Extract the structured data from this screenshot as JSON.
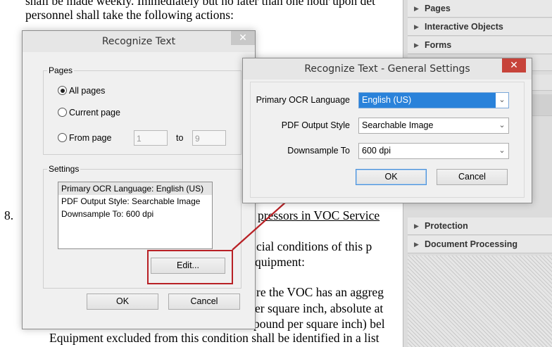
{
  "document": {
    "lines": [
      "shall be made weekly.  Immediately but no later than one hour upon det",
      "personnel shall take the following actions:",
      "8.",
      "pressors in VOC Service",
      "cial conditions of this p",
      "quipment:",
      "re the VOC has an aggreg",
      "er square inch, absolute at",
      "pound per square inch) bel",
      "Equipment excluded from this condition shall be identified in a list"
    ]
  },
  "panel": {
    "items": [
      {
        "label": "Pages"
      },
      {
        "label": "Interactive Objects"
      },
      {
        "label": "Forms"
      },
      {
        "label": "Protection"
      },
      {
        "label": "Document Processing"
      }
    ]
  },
  "recognize_dialog": {
    "title": "Recognize Text",
    "close": "✕",
    "pages_label": "Pages",
    "radio_all": "All pages",
    "radio_current": "Current page",
    "radio_from": "From page",
    "from_value": "1",
    "to_label": "to",
    "to_value": "9",
    "settings_label": "Settings",
    "settings_lines": [
      "Primary OCR Language: English (US)",
      "PDF Output Style: Searchable Image",
      "Downsample To: 600 dpi"
    ],
    "edit_button": "Edit...",
    "ok_button": "OK",
    "cancel_button": "Cancel"
  },
  "general_dialog": {
    "title": "Recognize Text - General Settings",
    "close": "✕",
    "language_label": "Primary OCR Language",
    "language_value": "English (US)",
    "output_label": "PDF Output Style",
    "output_value": "Searchable Image",
    "downsample_label": "Downsample To",
    "downsample_value": "600 dpi",
    "ok_button": "OK",
    "cancel_button": "Cancel"
  },
  "colors": {
    "highlight": "#b82025",
    "selection": "#2a82da",
    "close_button": "#c7433a"
  }
}
